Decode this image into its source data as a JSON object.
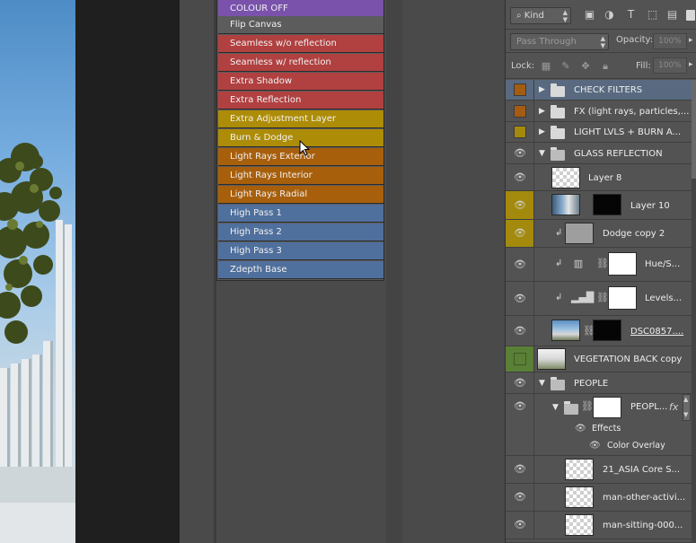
{
  "color_menu": {
    "items": [
      {
        "label": "COLOUR OFF",
        "color": "#7a52ab"
      },
      {
        "label": "Flip Canvas",
        "color": "#5c5c5c"
      },
      {
        "label": "Seamless w/o reflection",
        "color": "#b14040"
      },
      {
        "label": "Seamless w/ reflection",
        "color": "#b14040"
      },
      {
        "label": "Extra Shadow",
        "color": "#b14040"
      },
      {
        "label": "Extra Reflection",
        "color": "#b14040"
      },
      {
        "label": "Extra Adjustment Layer",
        "color": "#ad8c07"
      },
      {
        "label": "Burn & Dodge",
        "color": "#ad8c07"
      },
      {
        "label": "Light Rays Exterior",
        "color": "#a85f0c"
      },
      {
        "label": "Light Rays Interior",
        "color": "#a85f0c"
      },
      {
        "label": "Light Rays Radial",
        "color": "#a85f0c"
      },
      {
        "label": "High Pass 1",
        "color": "#4f6f9c"
      },
      {
        "label": "High Pass 2",
        "color": "#4f6f9c"
      },
      {
        "label": "High Pass 3",
        "color": "#4f6f9c"
      },
      {
        "label": "Zdepth Base",
        "color": "#4f6f9c"
      }
    ]
  },
  "layers_panel": {
    "filter_kind": "Kind",
    "blend_mode": "Pass Through",
    "opacity_label": "Opacity:",
    "opacity_value": "100%",
    "lock_label": "Lock:",
    "fill_label": "Fill:",
    "fill_value": "100%",
    "layers": [
      {
        "name": "CHECK FILTERS",
        "kind": "group",
        "label_color": "#a35c11",
        "selected": true
      },
      {
        "name": "FX (light rays, particles,...",
        "kind": "group",
        "label_color": "#a35c11"
      },
      {
        "name": "LIGHT LVLS + BURN A...",
        "kind": "group",
        "label_color": "#a38a0c"
      },
      {
        "name": "GLASS REFLECTION",
        "kind": "group-open"
      },
      {
        "name": "Layer 8",
        "kind": "layer"
      },
      {
        "name": "Layer 10",
        "kind": "layer-mask",
        "label_color": "#a38a0c"
      },
      {
        "name": "Dodge copy 2",
        "kind": "clipped",
        "label_color": "#a38a0c"
      },
      {
        "name": "Hue/S...",
        "kind": "adjustment"
      },
      {
        "name": "Levels...",
        "kind": "adjustment"
      },
      {
        "name": "DSC0857....",
        "kind": "smart"
      },
      {
        "name": "VEGETATION BACK copy",
        "kind": "layer",
        "label_color": "#5a7f36"
      },
      {
        "name": "PEOPLE",
        "kind": "group-open"
      },
      {
        "name": "PEOPL...",
        "kind": "group-fx"
      },
      {
        "name": "Effects",
        "kind": "effects"
      },
      {
        "name": "Color Overlay",
        "kind": "effect-item"
      },
      {
        "name": "21_ASIA Core S...",
        "kind": "smart"
      },
      {
        "name": "man-other-activi...",
        "kind": "smart"
      },
      {
        "name": "man-sitting-000...",
        "kind": "smart"
      }
    ],
    "fx_label": "fx"
  }
}
